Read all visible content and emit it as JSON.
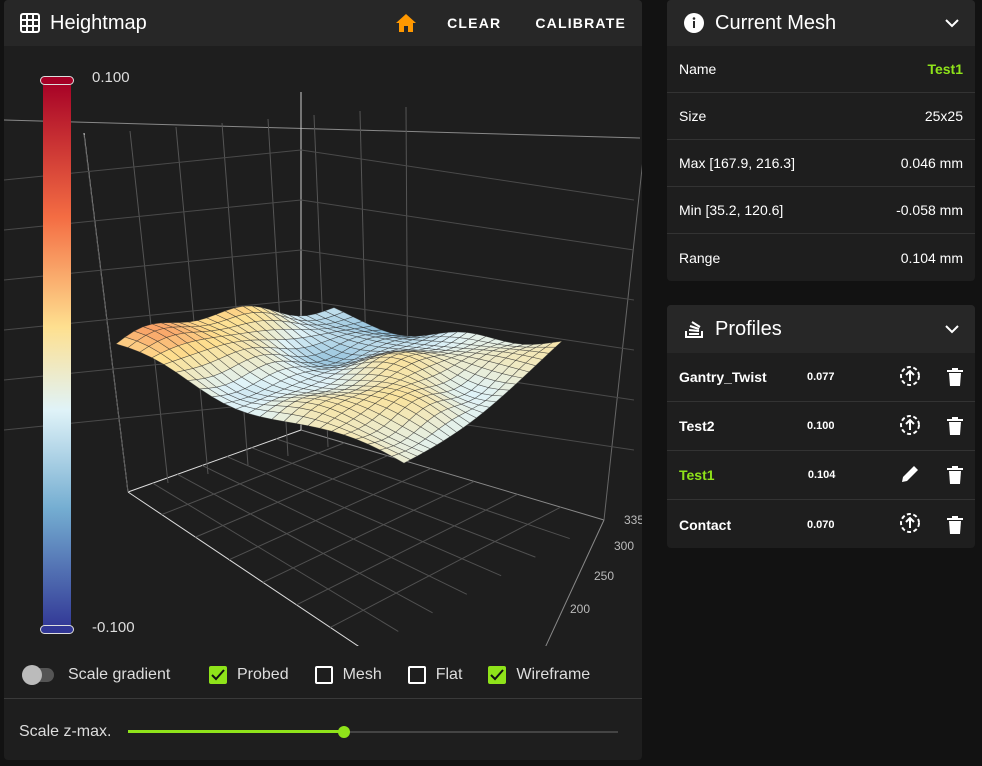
{
  "heightmap": {
    "title": "Heightmap",
    "icon": "grid-icon",
    "home_icon": "home-icon",
    "clear_label": "CLEAR",
    "calibrate_label": "CALIBRATE",
    "colorbar": {
      "max": "0.100",
      "min": "-0.100",
      "colors": [
        "#a50026",
        "#f46d43",
        "#fee090",
        "#e0f3f8",
        "#74add1",
        "#313695"
      ]
    },
    "axis_ticks": [
      "335",
      "300",
      "250",
      "200"
    ],
    "mesh_size": 25,
    "scale_gradient": {
      "label": "Scale gradient",
      "on": false
    },
    "checkboxes": [
      {
        "label": "Probed",
        "checked": true
      },
      {
        "label": "Mesh",
        "checked": false
      },
      {
        "label": "Flat",
        "checked": false
      },
      {
        "label": "Wireframe",
        "checked": true
      }
    ],
    "scale_zmax": {
      "label": "Scale z-max.",
      "value_fraction": 0.44
    },
    "accent": "#8fe31a",
    "home_color": "#ff9800"
  },
  "current_mesh": {
    "title": "Current Mesh",
    "icon": "info-icon",
    "rows": [
      {
        "label": "Name",
        "value": "Test1",
        "highlight": true
      },
      {
        "label": "Size",
        "value": "25x25"
      },
      {
        "label": "Max [167.9, 216.3]",
        "value": "0.046 mm"
      },
      {
        "label": "Min [35.2, 120.6]",
        "value": "-0.058 mm"
      },
      {
        "label": "Range",
        "value": "0.104 mm"
      }
    ]
  },
  "profiles": {
    "title": "Profiles",
    "icon": "layers-icon",
    "items": [
      {
        "name": "Gantry_Twist",
        "value": "0.077",
        "action": "load"
      },
      {
        "name": "Test2",
        "value": "0.100",
        "action": "load"
      },
      {
        "name": "Test1",
        "value": "0.104",
        "action": "edit",
        "active": true
      },
      {
        "name": "Contact",
        "value": "0.070",
        "action": "load"
      }
    ]
  }
}
